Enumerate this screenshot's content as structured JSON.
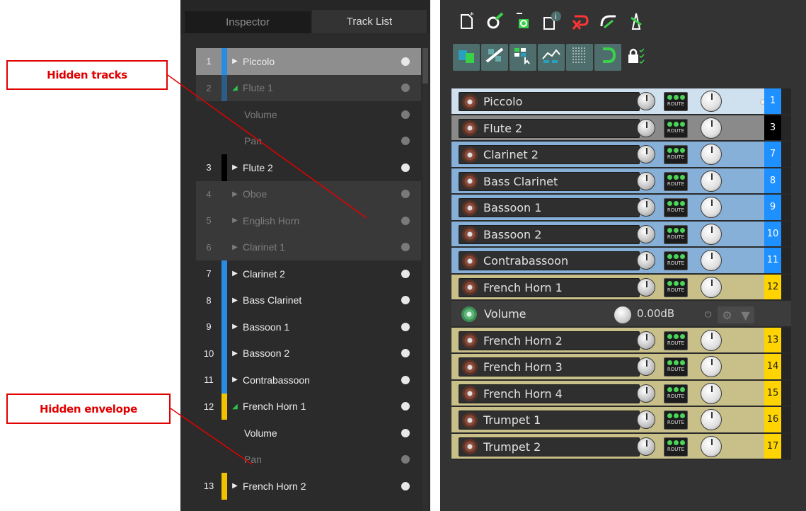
{
  "annotations": {
    "hidden_tracks": "Hidden tracks",
    "hidden_envelope": "Hidden envelope"
  },
  "tabs": {
    "inspector": "Inspector",
    "track_list": "Track List"
  },
  "track_list": [
    {
      "num": "1",
      "label": "Piccolo",
      "color": "#2a8ce0",
      "state": "selected",
      "kind": "track",
      "expander": "collapsed"
    },
    {
      "num": "2",
      "label": "Flute 1",
      "color": "#2a8ce0",
      "state": "hidden",
      "kind": "track",
      "expander": "expanded"
    },
    {
      "num": "",
      "label": "Volume",
      "color": "",
      "state": "hidden",
      "kind": "envelope",
      "expander": ""
    },
    {
      "num": "",
      "label": "Pan",
      "color": "",
      "state": "hidden",
      "kind": "envelope",
      "expander": ""
    },
    {
      "num": "3",
      "label": "Flute 2",
      "color": "#000000",
      "state": "normal",
      "kind": "track",
      "expander": "collapsed"
    },
    {
      "num": "4",
      "label": "Oboe",
      "color": "",
      "state": "hidden",
      "kind": "track",
      "expander": "collapsed"
    },
    {
      "num": "5",
      "label": "English Horn",
      "color": "",
      "state": "hidden",
      "kind": "track",
      "expander": "collapsed"
    },
    {
      "num": "6",
      "label": "Clarinet 1",
      "color": "",
      "state": "hidden",
      "kind": "track",
      "expander": "collapsed"
    },
    {
      "num": "7",
      "label": "Clarinet 2",
      "color": "#2a8ce0",
      "state": "normal",
      "kind": "track",
      "expander": "collapsed"
    },
    {
      "num": "8",
      "label": "Bass Clarinet",
      "color": "#2a8ce0",
      "state": "normal",
      "kind": "track",
      "expander": "collapsed"
    },
    {
      "num": "9",
      "label": "Bassoon 1",
      "color": "#2a8ce0",
      "state": "normal",
      "kind": "track",
      "expander": "collapsed"
    },
    {
      "num": "10",
      "label": "Bassoon 2",
      "color": "#2a8ce0",
      "state": "normal",
      "kind": "track",
      "expander": "collapsed"
    },
    {
      "num": "11",
      "label": "Contrabassoon",
      "color": "#2a8ce0",
      "state": "normal",
      "kind": "track",
      "expander": "collapsed"
    },
    {
      "num": "12",
      "label": "French Horn 1",
      "color": "#f2c200",
      "state": "normal",
      "kind": "track",
      "expander": "expanded"
    },
    {
      "num": "",
      "label": "Volume",
      "color": "",
      "state": "normal",
      "kind": "envelope",
      "expander": ""
    },
    {
      "num": "",
      "label": "Pan",
      "color": "",
      "state": "dim",
      "kind": "envelope",
      "expander": ""
    },
    {
      "num": "13",
      "label": "French Horn 2",
      "color": "#f2c200",
      "state": "normal",
      "kind": "track",
      "expander": "collapsed"
    }
  ],
  "toolbar": {
    "row1_icons": [
      "new-project-icon",
      "save-project-icon",
      "open-project-icon",
      "project-info-icon",
      "undo-icon",
      "redo-icon",
      "metronome-icon"
    ],
    "row2_icons": [
      "snap-icon",
      "ripple-edit-icon",
      "grid-items-icon",
      "envelope-points-icon",
      "grid-lines-icon",
      "loop-icon",
      "lock-icon"
    ],
    "lock_label": "🔒"
  },
  "tcp": [
    {
      "name": "Piccolo",
      "num": "1",
      "bg": "#cfe0ef",
      "num_bg": "#1e90ff",
      "num_color": "#ffffff",
      "kind": "track"
    },
    {
      "name": "Flute 2",
      "num": "3",
      "bg": "#8a8a8a",
      "num_bg": "#000000",
      "num_color": "#ffffff",
      "kind": "track"
    },
    {
      "name": "Clarinet 2",
      "num": "7",
      "bg": "#86b0d8",
      "num_bg": "#1e90ff",
      "num_color": "#ffffff",
      "kind": "track"
    },
    {
      "name": "Bass Clarinet",
      "num": "8",
      "bg": "#86b0d8",
      "num_bg": "#1e90ff",
      "num_color": "#ffffff",
      "kind": "track"
    },
    {
      "name": "Bassoon 1",
      "num": "9",
      "bg": "#86b0d8",
      "num_bg": "#1e90ff",
      "num_color": "#ffffff",
      "kind": "track"
    },
    {
      "name": "Bassoon 2",
      "num": "10",
      "bg": "#86b0d8",
      "num_bg": "#1e90ff",
      "num_color": "#ffffff",
      "kind": "track"
    },
    {
      "name": "Contrabassoon",
      "num": "11",
      "bg": "#86b0d8",
      "num_bg": "#1e90ff",
      "num_color": "#ffffff",
      "kind": "track"
    },
    {
      "name": "French Horn 1",
      "num": "12",
      "bg": "#c8c088",
      "num_bg": "#ffd400",
      "num_color": "#222222",
      "kind": "track"
    },
    {
      "name": "Volume",
      "value": "0.00dB",
      "kind": "envelope"
    },
    {
      "name": "French Horn 2",
      "num": "13",
      "bg": "#c8c088",
      "num_bg": "#ffd400",
      "num_color": "#222222",
      "kind": "track"
    },
    {
      "name": "French Horn 3",
      "num": "14",
      "bg": "#c8c088",
      "num_bg": "#ffd400",
      "num_color": "#222222",
      "kind": "track"
    },
    {
      "name": "French Horn 4",
      "num": "15",
      "bg": "#c8c088",
      "num_bg": "#ffd400",
      "num_color": "#222222",
      "kind": "track"
    },
    {
      "name": "Trumpet 1",
      "num": "16",
      "bg": "#c8c088",
      "num_bg": "#ffd400",
      "num_color": "#222222",
      "kind": "track"
    },
    {
      "name": "Trumpet 2",
      "num": "17",
      "bg": "#c8c088",
      "num_bg": "#ffd400",
      "num_color": "#222222",
      "kind": "track"
    }
  ],
  "route_label": "ROUTE",
  "colors": {
    "annotation": "#e10000",
    "selected_row": "#8e8e8e",
    "hidden_row": "#393939",
    "blue_track": "#2a8ce0",
    "yellow_track": "#f2c200"
  }
}
